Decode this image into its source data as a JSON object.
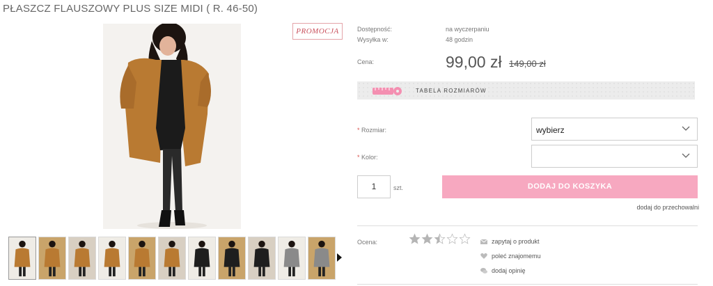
{
  "product": {
    "title": "PŁASZCZ FLAUSZOWY PLUS SIZE MIDI ( R. 46-50)",
    "promo_badge": "PROMOCJA"
  },
  "gallery": {
    "thumbnail_count": 11,
    "thumb_colors": [
      "#b97a32",
      "#b97a32",
      "#b97a32",
      "#b97a32",
      "#b97a32",
      "#b97a32",
      "#1e1e1e",
      "#1e1e1e",
      "#1e1e1e",
      "#8a8a8a",
      "#8a8a8a"
    ]
  },
  "details": {
    "availability_label": "Dostępność:",
    "availability_value": "na wyczerpaniu",
    "shipping_label": "Wysyłka w:",
    "shipping_value": "48 godzin",
    "price_label": "Cena:",
    "price": "99,00 zł",
    "old_price": "149,00 zł"
  },
  "size_table": {
    "label": "TABELA ROZMIARÓW"
  },
  "options": {
    "size_label": "Rozmiar:",
    "size_value": "wybierz",
    "color_label": "Kolor:",
    "color_value": "",
    "required_mark": "*"
  },
  "cart": {
    "quantity": "1",
    "unit": "szt.",
    "add_button": "DODAJ DO KOSZYKA",
    "wishlist_link": "dodaj do przechowalni"
  },
  "rating": {
    "label": "Ocena:",
    "value": 2.5,
    "max": 5
  },
  "actions": {
    "ask": "zapytaj o produkt",
    "recommend": "poleć znajomemu",
    "review": "dodaj opinię"
  },
  "colors": {
    "accent_pink": "#f7a8c0",
    "promo_red": "#c9505c",
    "coat_camel": "#b97a32"
  }
}
